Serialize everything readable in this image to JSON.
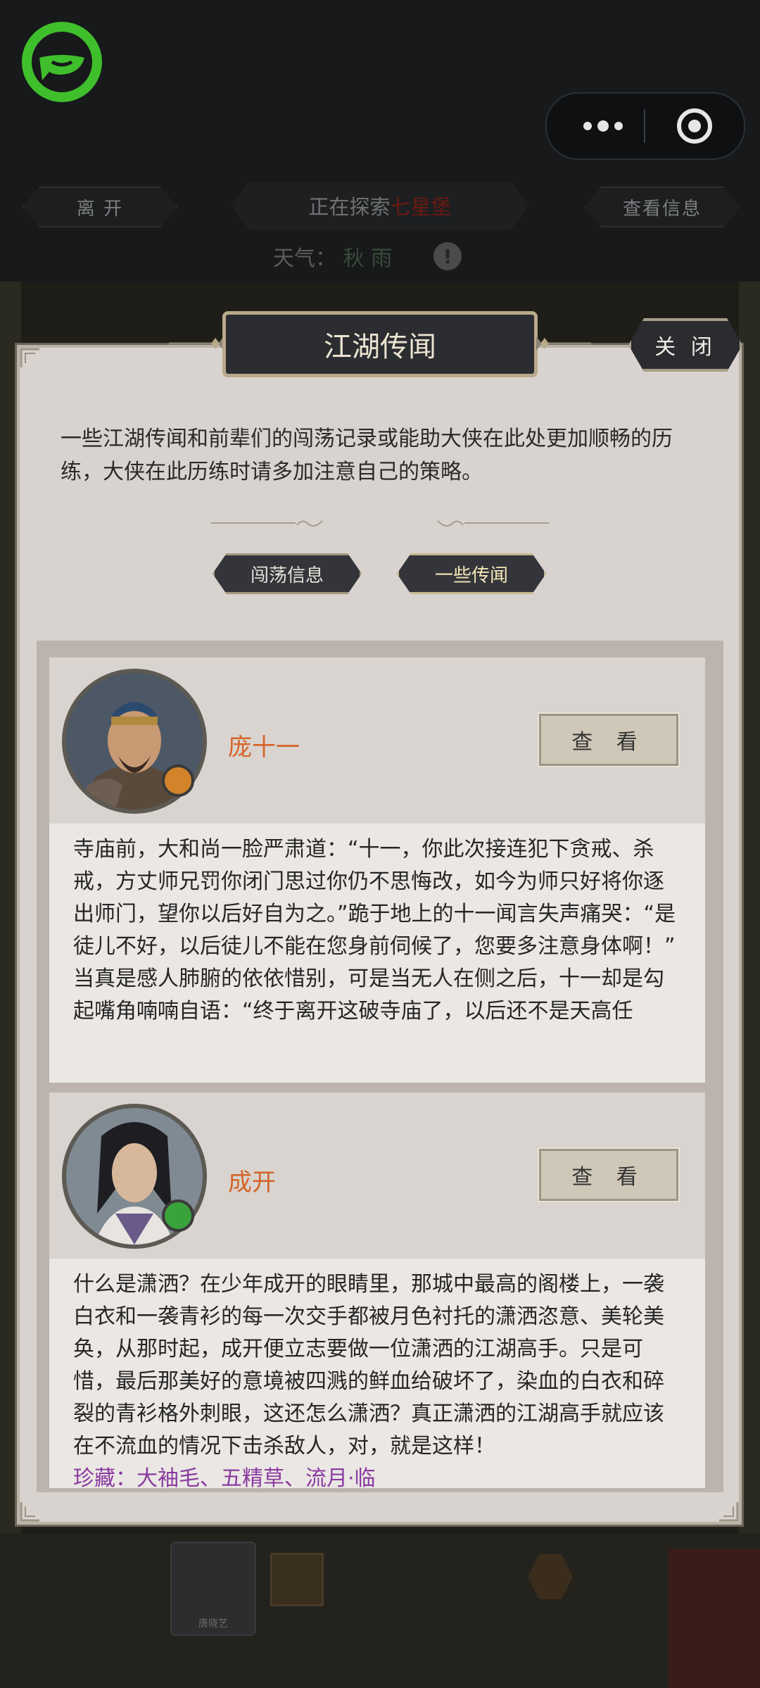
{
  "header": {
    "leave_label": "离  开",
    "exploring_prefix": "正在探索",
    "location": "七星堡",
    "view_info_label": "查看信息",
    "weather_label": "天气：",
    "weather_value": "秋 雨"
  },
  "scene": {
    "npc_label": "唐晓艺"
  },
  "modal": {
    "title": "江湖传闻",
    "close_label": "关 闭",
    "intro": "一些江湖传闻和前辈们的闯荡记录或能助大侠在此处更加顺畅的历练，大侠在此历练时请多加注意自己的策略。",
    "tabs": [
      {
        "label": "闯荡信息",
        "active": false
      },
      {
        "label": "一些传闻",
        "active": true
      }
    ],
    "entries": [
      {
        "name": "庞十一",
        "view_label": "查 看",
        "text1": "寺庙前，大和尚一脸严肃道：“十一，你此次接连犯下贪戒、杀戒，方丈师兄罚你闭门思过你仍不思悔改，如今为师只好将你逐出师门，望你以后好自为之。”跪于地上的十一闻言失声痛哭：“是徒儿不好，以后徒儿不能在您身前伺候了，您要多注意身体啊！”",
        "text2": "当真是感人肺腑的依依惜别，可是当无人在侧之后，十一却是勾起嘴角喃喃自语：“终于离开这破寺庙了，以后还不是天高任"
      },
      {
        "name": "成开",
        "view_label": "查 看",
        "text1": "什么是潇洒？在少年成开的眼睛里，那城中最高的阁楼上，一袭白衣和一袭青衫的每一次交手都被月色衬托的潇洒恣意、美轮美奂，从那时起，成开便立志要做一位潇洒的江湖高手。只是可惜，最后那美好的意境被四溅的鲜血给破坏了，染血的白衣和碎裂的青衫格外刺眼，这还怎么潇洒？真正潇洒的江湖高手就应该在不流血的情况下击杀敌人，对，就是这样！",
        "text2": "珍藏：大袖毛、五精草、流月·临"
      }
    ]
  },
  "colors": {
    "accent_name": "#d46428",
    "logo_green": "#3fbf2b"
  }
}
